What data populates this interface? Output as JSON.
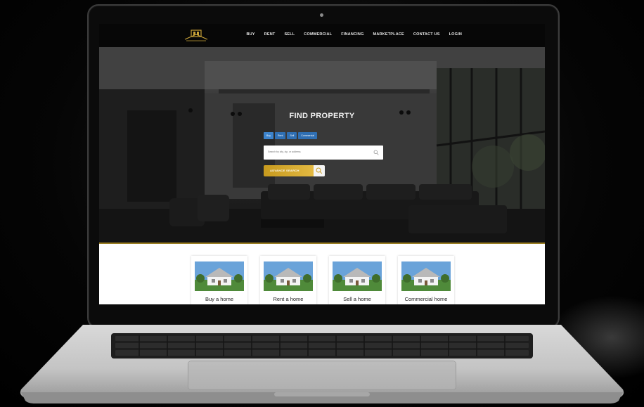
{
  "nav": {
    "links": [
      "BUY",
      "RENT",
      "SELL",
      "COMMERCIAL",
      "FINANCING",
      "MARKETPLACE",
      "CONTACT US",
      "LOGIN"
    ]
  },
  "hero": {
    "title": "FIND PROPERTY",
    "tabs": [
      "Buy",
      "Rent",
      "Sell",
      "Commercial"
    ],
    "search_placeholder": "Search by city, zip, or address",
    "advanced_button": "ADVANCE SEARCH"
  },
  "cards": [
    {
      "label": "Buy a home"
    },
    {
      "label": "Rent a home"
    },
    {
      "label": "Sell a home"
    },
    {
      "label": "Commercial home"
    }
  ],
  "colors": {
    "accent_gold": "#c79a1e",
    "tab_blue": "#2f6fb3",
    "nav_bg": "#070707"
  },
  "icons": [
    "house-logo-icon",
    "search-icon",
    "search-icon"
  ]
}
